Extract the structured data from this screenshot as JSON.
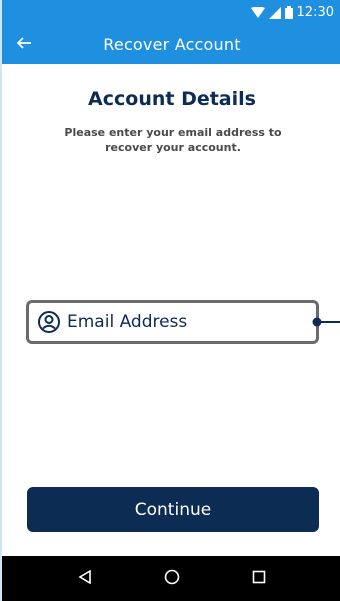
{
  "status_bar": {
    "time": "12:30",
    "icons": [
      "wifi-icon",
      "signal-icon",
      "battery-icon"
    ]
  },
  "app_bar": {
    "title": "Recover Account",
    "back_icon": "back-arrow-icon"
  },
  "content": {
    "heading": "Account Details",
    "subtitle": "Please enter your email address to recover your account."
  },
  "email_field": {
    "placeholder": "Email Address",
    "value": "",
    "icon": "user-circle-icon"
  },
  "continue_button": {
    "label": "Continue"
  },
  "nav_bar": {
    "icons": [
      "back-triangle-icon",
      "home-circle-icon",
      "recents-square-icon"
    ]
  },
  "colors": {
    "app_bar": "#1f8fe0",
    "primary_dark": "#0d2c54",
    "field_border": "#6b6b6b",
    "subtitle_text": "#4a4a4a",
    "nav_bar": "#000000"
  }
}
